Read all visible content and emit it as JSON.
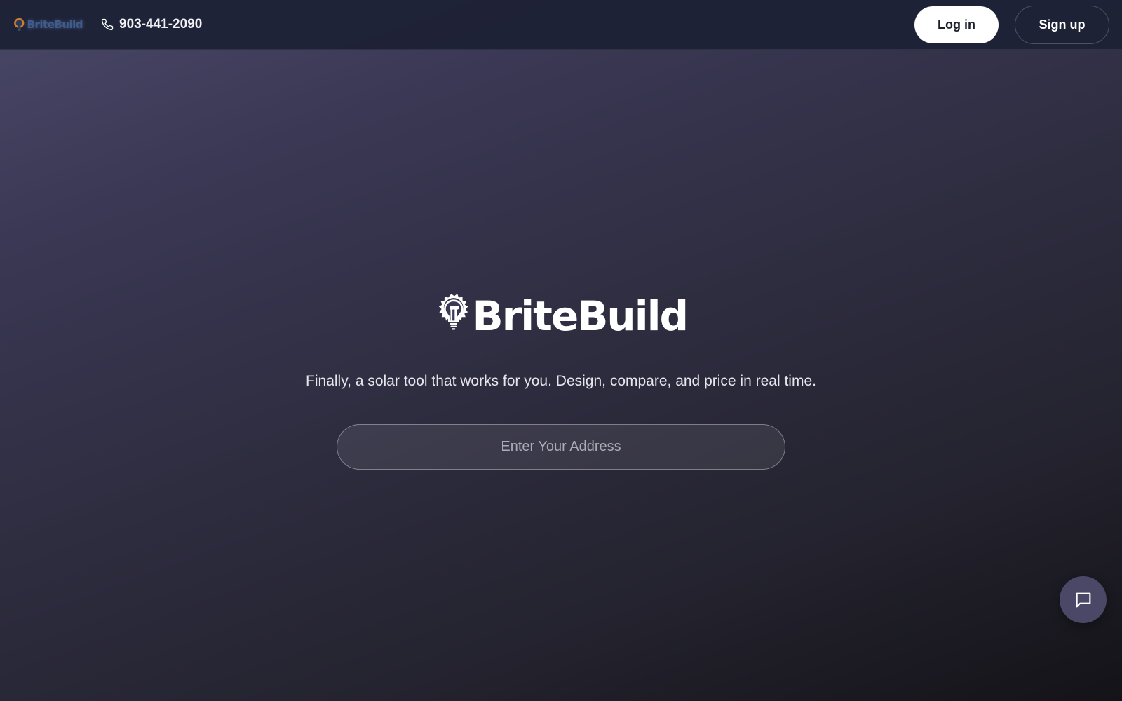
{
  "header": {
    "brand_name": "BriteBuild",
    "phone_icon": "phone-icon",
    "phone_number": "903-441-2090",
    "login_label": "Log in",
    "signup_label": "Sign up"
  },
  "hero": {
    "logo_icon": "gear-lightbulb-logo-icon",
    "brand_name": "BriteBuild",
    "tagline": "Finally, a solar tool that works for you. Design, compare, and price in real time.",
    "address_placeholder": "Enter Your Address",
    "address_value": ""
  },
  "chat": {
    "icon": "chat-bubble-icon"
  },
  "colors": {
    "topbar": "#1c2134",
    "background_top": "#4a4868",
    "background_bottom": "#141318",
    "button_primary": "#ffffff",
    "chat_button": "#4a4866"
  }
}
